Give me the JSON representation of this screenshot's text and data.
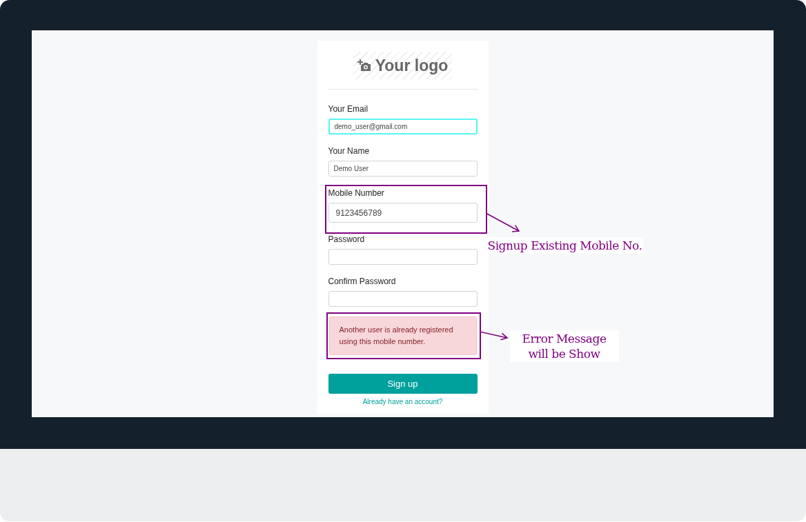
{
  "logo": {
    "text": "Your logo"
  },
  "fields": [
    {
      "label": "Your Email",
      "value": "demo_user@gmail.com",
      "focused": true,
      "highlighted": false,
      "kind": "compact"
    },
    {
      "label": "Your Name",
      "value": "Demo User",
      "focused": false,
      "highlighted": false,
      "kind": "compact"
    },
    {
      "label": "Mobile Number",
      "value": "9123456789",
      "focused": false,
      "highlighted": true,
      "kind": "tall",
      "annotation": "Signup Existing Mobile No."
    },
    {
      "label": "Password",
      "focused": false,
      "highlighted": false,
      "kind": "compact"
    },
    {
      "label": "Confirm Password",
      "focused": false,
      "highlighted": false,
      "kind": "compact"
    }
  ],
  "error": {
    "message": "Another user is already registered using this mobile number.",
    "highlighted": true,
    "annotation": "Error Message will be Show"
  },
  "submit_button": {
    "label": "Sign up"
  },
  "login_link": {
    "label": "Already have an account?"
  }
}
